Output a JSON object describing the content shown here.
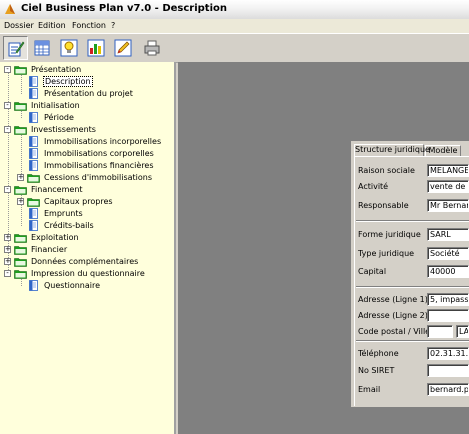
{
  "window": {
    "title": "Ciel Business Plan v7.0 - Description"
  },
  "menu": [
    "Dossier",
    "Edition",
    "Fonction",
    "?"
  ],
  "toolbar": {
    "buttons": [
      "edit-document-icon",
      "spreadsheet-icon",
      "lightbulb-icon",
      "bar-chart-icon",
      "pencil-icon",
      "printer-icon"
    ]
  },
  "tree": {
    "nodes": [
      {
        "label": "Présentation",
        "kind": "folder",
        "sign": "-"
      },
      {
        "label": "Description",
        "kind": "page",
        "selected": true
      },
      {
        "label": "Présentation du projet",
        "kind": "page"
      },
      {
        "label": "Initialisation",
        "kind": "folder",
        "sign": "-"
      },
      {
        "label": "Période",
        "kind": "page"
      },
      {
        "label": "Investissements",
        "kind": "folder",
        "sign": "-"
      },
      {
        "label": "Immobilisations incorporelles",
        "kind": "page"
      },
      {
        "label": "Immobilisations corporelles",
        "kind": "page"
      },
      {
        "label": "Immobilisations financières",
        "kind": "page"
      },
      {
        "label": "Cessions d'immobilisations",
        "kind": "folder",
        "sign": "+"
      },
      {
        "label": "Financement",
        "kind": "folder",
        "sign": "-"
      },
      {
        "label": "Capitaux propres",
        "kind": "folder",
        "sign": "+"
      },
      {
        "label": "Emprunts",
        "kind": "page"
      },
      {
        "label": "Crédits-bails",
        "kind": "page"
      },
      {
        "label": "Exploitation",
        "kind": "folder",
        "sign": "+"
      },
      {
        "label": "Financier",
        "kind": "folder",
        "sign": "+"
      },
      {
        "label": "Données complémentaires",
        "kind": "folder",
        "sign": "+"
      },
      {
        "label": "Impression du questionnaire",
        "kind": "folder",
        "sign": "-"
      },
      {
        "label": "Questionnaire",
        "kind": "page"
      }
    ]
  },
  "form": {
    "tabs": [
      "Structure juridique",
      "Modèle"
    ],
    "active_tab": "Structure juridique",
    "fields": [
      {
        "label": "Raison sociale",
        "value": "MELANGEUR"
      },
      {
        "label": "Activité",
        "value": "vente de m"
      },
      {
        "label": "Responsable",
        "value": "Mr Bernard"
      },
      {
        "label": "Forme juridique",
        "value": "SARL"
      },
      {
        "label": "Type juridique",
        "value": "Société"
      },
      {
        "label": "Capital",
        "value": "40000"
      },
      {
        "label": "Adresse (Ligne 1)",
        "value": "5, impasse"
      },
      {
        "label": "Adresse (Ligne 2)",
        "value": ""
      },
      {
        "label": "Code postal / Ville",
        "value": "",
        "value2": "LA"
      },
      {
        "label": "Téléphone",
        "value": "02.31.31.1"
      },
      {
        "label": "No SIRET",
        "value": ""
      },
      {
        "label": "Email",
        "value": "bernard.plu"
      }
    ]
  },
  "colors": {
    "tree_bg": "#ffffdc",
    "folder": "#1e9e1e",
    "page": "#2f66c8",
    "workspace": "#808080",
    "panel": "#d4d0c8"
  }
}
